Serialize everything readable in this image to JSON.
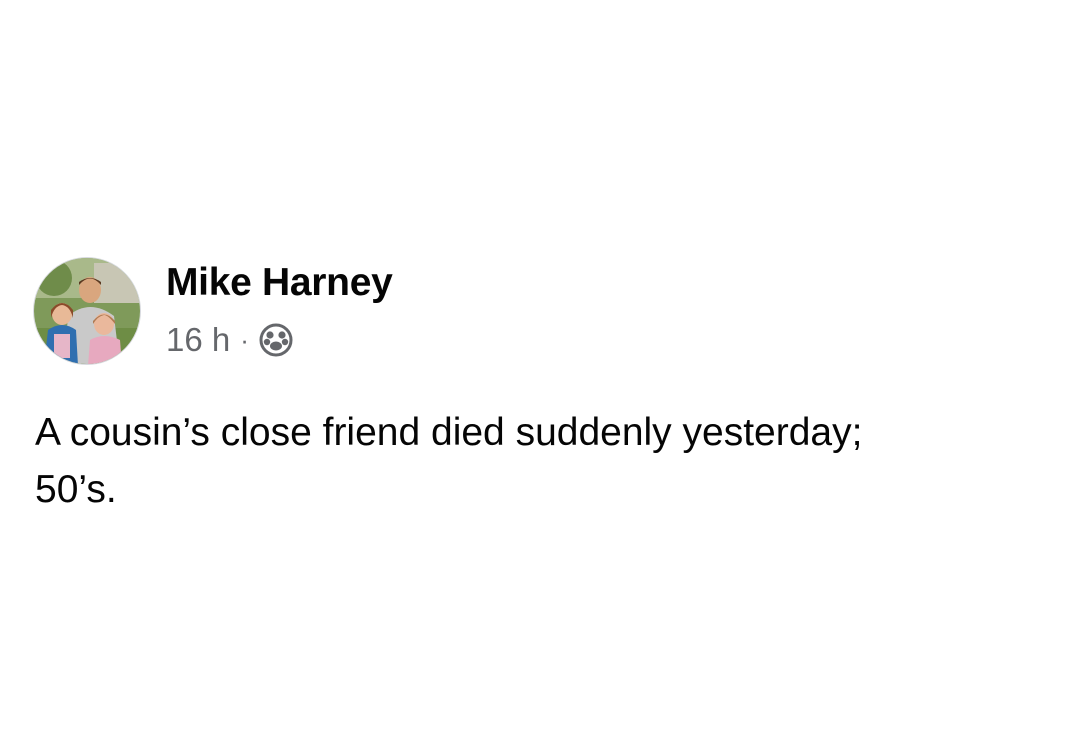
{
  "post": {
    "author": {
      "name": "Mike Harney",
      "avatar_icon": "profile-photo"
    },
    "timestamp": "16 h",
    "separator": "·",
    "audience_icon": "friends-audience-icon",
    "text": "A cousin’s close friend died suddenly yesterday;\n50’s."
  },
  "colors": {
    "text_primary": "#050505",
    "text_secondary": "#65676b",
    "background": "#ffffff"
  }
}
